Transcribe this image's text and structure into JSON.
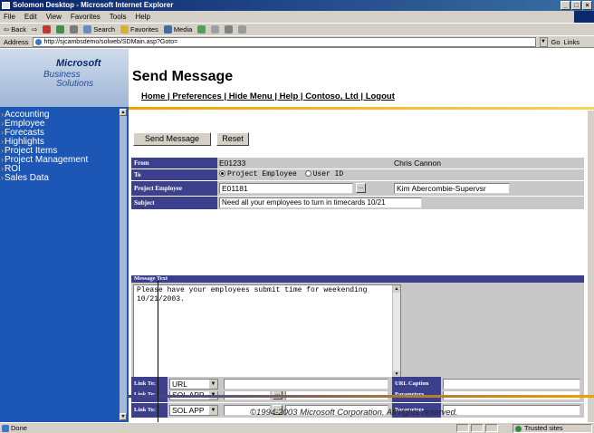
{
  "window": {
    "title": "Solomon Desktop - Microsoft Internet Explorer"
  },
  "menu": [
    "File",
    "Edit",
    "View",
    "Favorites",
    "Tools",
    "Help"
  ],
  "toolbar": {
    "back": "Back",
    "search": "Search",
    "favorites": "Favorites",
    "media": "Media"
  },
  "address": {
    "label": "Address",
    "url": "http://sjcambsdemo/solweb/SDMain.asp?Goto=",
    "go": "Go",
    "links": "Links"
  },
  "logo": {
    "line1": "Microsoft",
    "line2": "Business",
    "line3": "Solutions"
  },
  "sidebar": {
    "items": [
      "Accounting",
      "Employee",
      "Forecasts",
      "Highlights",
      "Project Items",
      "Project Management",
      "ROI",
      "Sales Data"
    ]
  },
  "page": {
    "title": "Send Message"
  },
  "topnav": [
    "Home",
    "Preferences",
    "Hide Menu",
    "Help",
    "Contoso, Ltd",
    "Logout"
  ],
  "buttons": {
    "send": "Send Message",
    "reset": "Reset"
  },
  "form": {
    "from_label": "From",
    "from_id": "E01233",
    "from_name": "Chris Cannon",
    "to_label": "To",
    "to_opt1": "Project Employee",
    "to_opt2": "User ID",
    "proj_emp_label": "Project Employee",
    "proj_emp_value": "E01181",
    "proj_emp_name": "Kim Abercombie-Supervsr",
    "subject_label": "Subject",
    "subject_value": "Need all your employees to turn in timecards 10/21"
  },
  "message": {
    "label": "Message Text",
    "line1": "Please have your employees submit time for weekending",
    "line2": "10/21/2003."
  },
  "links": {
    "rows": [
      {
        "label": "Link To:",
        "select": "SOL APP",
        "param_label": "Parameters"
      },
      {
        "label": "Link To:",
        "select": "SOL APP",
        "param_label": "Parameters"
      },
      {
        "label": "Link To:",
        "select": "URL",
        "param_label": "URL Caption"
      }
    ]
  },
  "footer": {
    "copyright": "©1994-2003 Microsoft Corporation. All rights reserved."
  },
  "status": {
    "text": "Done",
    "zone": "Trusted sites"
  }
}
